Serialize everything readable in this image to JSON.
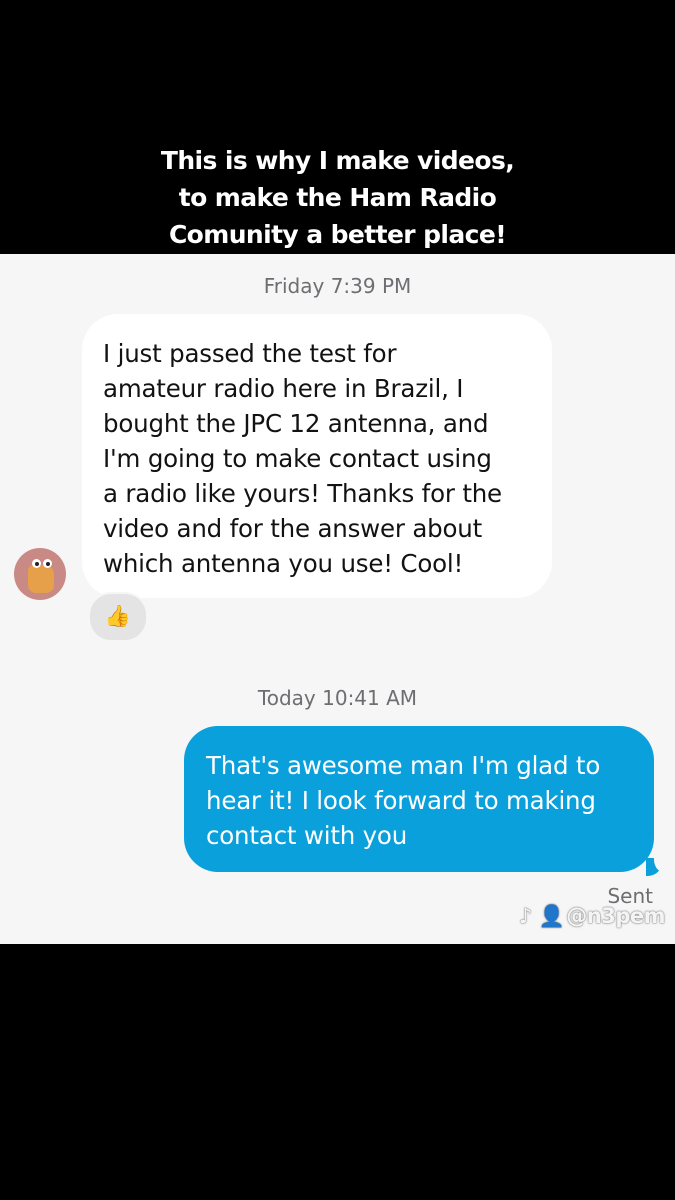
{
  "caption": {
    "lines": [
      "This is why I make videos,",
      "to make the Ham Radio",
      "Comunity a better place!"
    ]
  },
  "chat": {
    "received": {
      "timestamp": "Friday 7:39 PM",
      "lines": [
        "I just passed the test for",
        "amateur radio here in Brazil, I",
        "bought the JPC 12 antenna, and",
        "I'm going to make contact using",
        "a radio like yours! Thanks for the",
        "video and for the answer about",
        "which antenna you use! Cool!"
      ],
      "reaction": "👍"
    },
    "sent": {
      "timestamp": "Today 10:41 AM",
      "lines": [
        "That's awesome man I'm glad to",
        "hear it! I look forward to making",
        "contact with you"
      ],
      "status": "Sent"
    }
  },
  "watermark": {
    "icons": "♪ 👤",
    "handle": "@n3pem"
  },
  "colors": {
    "background_top": "#000000",
    "chat_background": "#f6f6f6",
    "incoming_bubble": "#ffffff",
    "outgoing_bubble": "#0aa0dc",
    "timestamp_text": "#6e6e72"
  }
}
